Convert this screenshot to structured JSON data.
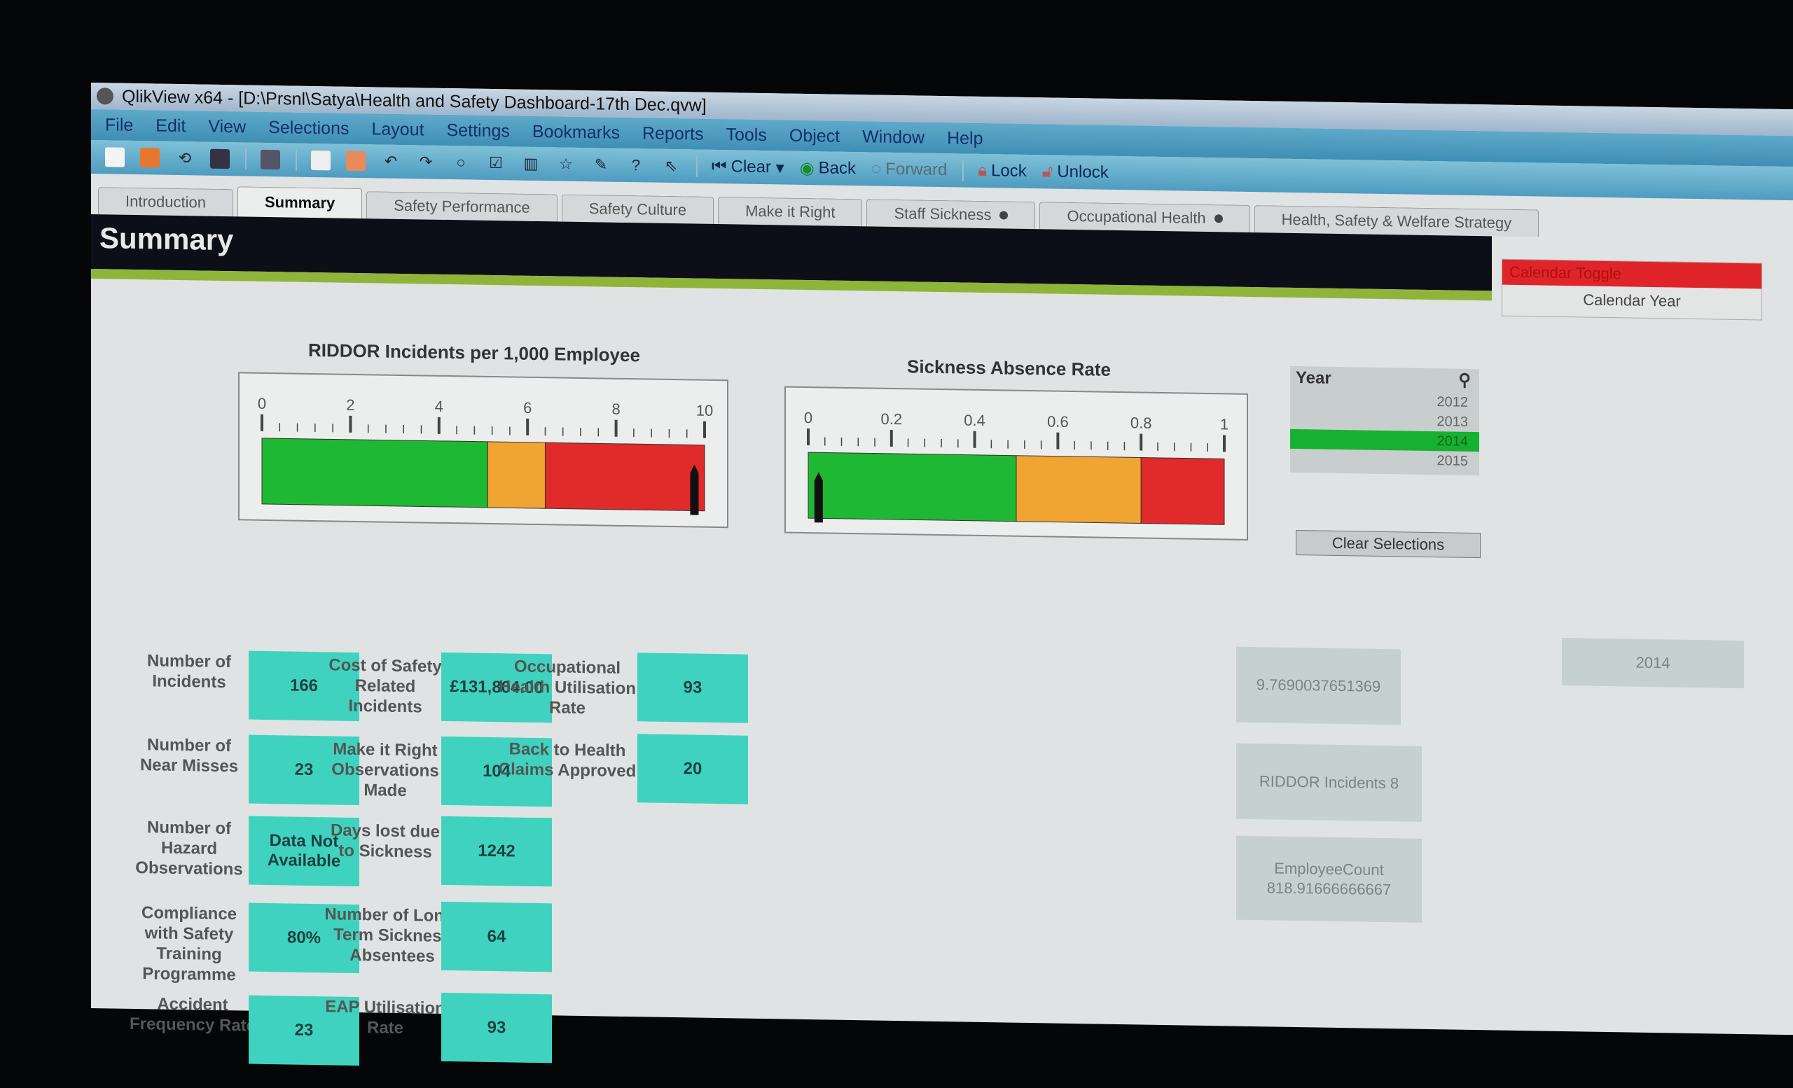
{
  "window": {
    "title": "QlikView x64 - [D:\\Prsnl\\Satya\\Health and Safety Dashboard-17th Dec.qvw]"
  },
  "menu": [
    "File",
    "Edit",
    "View",
    "Selections",
    "Layout",
    "Settings",
    "Bookmarks",
    "Reports",
    "Tools",
    "Object",
    "Window",
    "Help"
  ],
  "toolbar": {
    "icons": [
      "new-icon",
      "open-icon",
      "reload-icon",
      "save-icon",
      "print-icon",
      "edit-script-icon",
      "reload-doc-icon",
      "undo-icon",
      "redo-icon",
      "search-icon",
      "checkbox-icon",
      "chart-icon",
      "star-icon",
      "edit-icon",
      "help-icon",
      "help-pointer-icon"
    ],
    "clear": "Clear",
    "back": "Back",
    "forward": "Forward",
    "lock": "Lock",
    "unlock": "Unlock"
  },
  "tabs": [
    {
      "label": "Introduction",
      "active": false
    },
    {
      "label": "Summary",
      "active": true
    },
    {
      "label": "Safety Performance",
      "active": false
    },
    {
      "label": "Safety Culture",
      "active": false
    },
    {
      "label": "Make it Right",
      "active": false
    },
    {
      "label": "Staff Sickness",
      "active": false,
      "dot": true
    },
    {
      "label": "Occupational Health",
      "active": false,
      "dot": true
    },
    {
      "label": "Health, Safety & Welfare Strategy",
      "active": false
    }
  ],
  "sheet": {
    "title": "Summary"
  },
  "calendar_toggle": {
    "header": "Calendar Toggle",
    "value": "Calendar Year"
  },
  "gauges": {
    "riddor": {
      "title": "RIDDOR Incidents per 1,000 Employee",
      "min": 0,
      "max": 10,
      "ticks": [
        "0",
        "2",
        "4",
        "6",
        "8",
        "10"
      ],
      "bands": [
        {
          "to": 5.1,
          "color": "#1fb832"
        },
        {
          "to": 6.4,
          "color": "#f0a431"
        },
        {
          "to": 10,
          "color": "#e12a2a"
        }
      ],
      "value": 9.77
    },
    "sickness": {
      "title": "Sickness Absence Rate",
      "min": 0,
      "max": 1,
      "ticks": [
        "0",
        "0.2",
        "0.4",
        "0.6",
        "0.8",
        "1"
      ],
      "bands": [
        {
          "to": 0.5,
          "color": "#1fb832"
        },
        {
          "to": 0.8,
          "color": "#f0a431"
        },
        {
          "to": 1,
          "color": "#e12a2a"
        }
      ],
      "value": 0.025
    }
  },
  "year_list": {
    "header": "Year",
    "items": [
      "2012",
      "2013",
      "2014",
      "2015"
    ],
    "selected": "2014"
  },
  "clear_selections": "Clear Selections",
  "kpis": [
    {
      "label": "Number of Incidents",
      "value": "166"
    },
    {
      "label": "Number of Near Misses",
      "value": "23"
    },
    {
      "label": "Number of Hazard Observations",
      "value": "Data Not Available"
    },
    {
      "label": "Compliance with Safety Training Programme",
      "value": "80%"
    },
    {
      "label": "Accident Frequency Rate",
      "value": "23"
    },
    {
      "label": "Cost of Safety Related Incidents",
      "value": "£131,804.00"
    },
    {
      "label": "Make it Right Observations Made",
      "value": "104"
    },
    {
      "label": "Days lost due to Sickness",
      "value": "1242"
    },
    {
      "label": "Number of Long-Term Sickness Absentees",
      "value": "64"
    },
    {
      "label": "EAP Utilisation Rate",
      "value": "93"
    },
    {
      "label": "Occupational Health Utilisation Rate",
      "value": "93"
    },
    {
      "label": "Back to Health Claims Approved",
      "value": "20"
    }
  ],
  "debug_boxes": {
    "riddor_rate": "9.7690037651369",
    "riddor_incidents": "RIDDOR Incidents  8",
    "employee_count": "EmployeeCount 818.91666666667",
    "year": "2014"
  }
}
